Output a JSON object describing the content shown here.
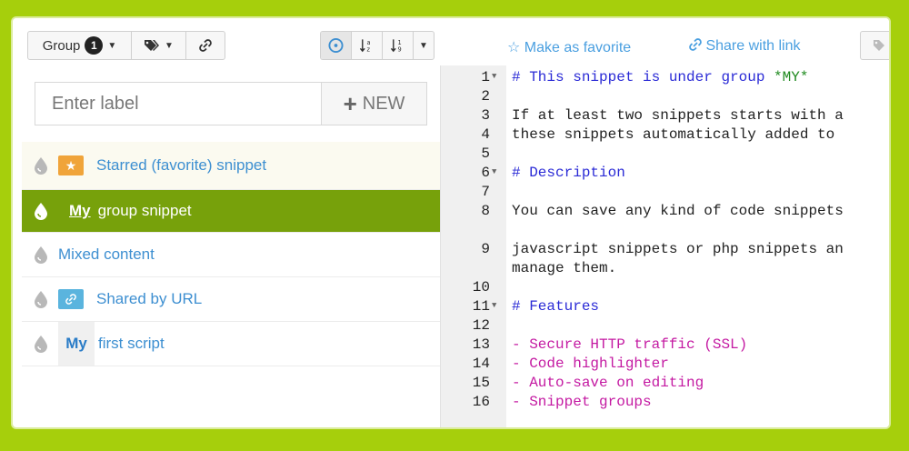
{
  "toolbar": {
    "group_label": "Group",
    "group_count": "1",
    "favorite_label": "Make as favorite",
    "share_label": "Share with link"
  },
  "label_input": {
    "placeholder": "Enter label"
  },
  "new_button": {
    "label": "NEW"
  },
  "snippets": [
    {
      "prefix": "",
      "label": "Starred (favorite) snippet"
    },
    {
      "prefix": "My",
      "label": "group snippet"
    },
    {
      "prefix": "",
      "label": "Mixed content"
    },
    {
      "prefix": "",
      "label": "Shared by URL"
    },
    {
      "prefix": "My",
      "label": "first script"
    }
  ],
  "editor": {
    "lines": [
      {
        "n": "1",
        "text": "# This snippet is under group ",
        "em": "*MY*"
      },
      {
        "n": "2",
        "text": ""
      },
      {
        "n": "3",
        "text": "If at least two snippets starts with a"
      },
      {
        "n": "4",
        "text": "these snippets automatically added to"
      },
      {
        "n": "5",
        "text": ""
      },
      {
        "n": "6",
        "text": "# Description"
      },
      {
        "n": "7",
        "text": ""
      },
      {
        "n": "8",
        "text": "You can save any kind of code snippets"
      },
      {
        "n": "9",
        "text": "javascript snippets or php snippets an"
      },
      {
        "n": "",
        "text": "manage them."
      },
      {
        "n": "10",
        "text": ""
      },
      {
        "n": "11",
        "text": "# Features"
      },
      {
        "n": "12",
        "text": ""
      },
      {
        "n": "13",
        "text": "- Secure HTTP traffic (SSL)"
      },
      {
        "n": "14",
        "text": "- Code highlighter"
      },
      {
        "n": "15",
        "text": "- Auto-save on editing"
      },
      {
        "n": "16",
        "text": "- Snippet groups"
      }
    ]
  },
  "colors": {
    "background": "#a6cf0c",
    "active_item": "#77a10b",
    "link": "#3d8fd1",
    "star_tag": "#f0a43a",
    "link_tag": "#5ab4de"
  }
}
